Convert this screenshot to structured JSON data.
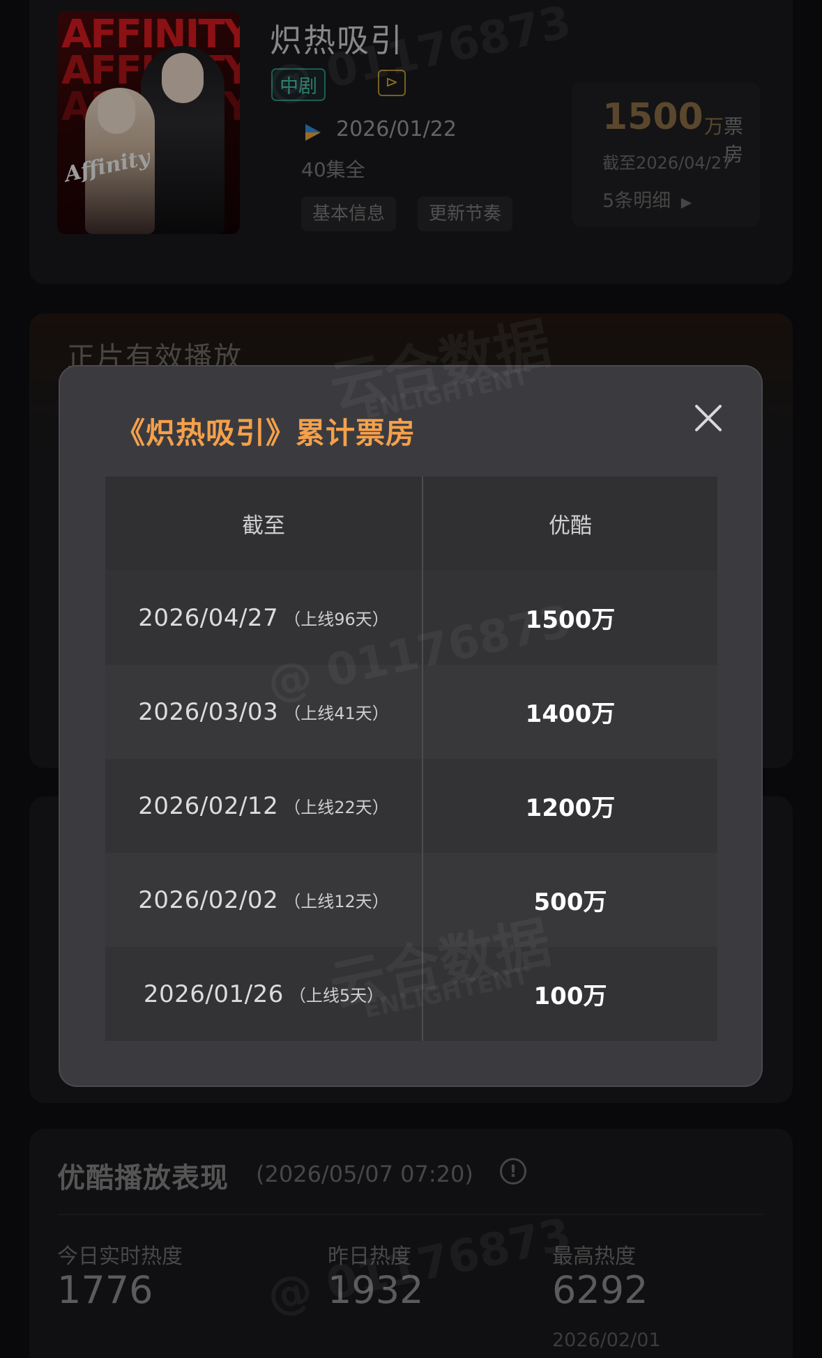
{
  "header": {
    "title": "炽热吸引",
    "genre_tag": "中剧",
    "release_date": "2026/01/22",
    "episodes": "40集全",
    "chips": [
      "基本信息",
      "更新节奏"
    ],
    "poster_title": "AFFINITY",
    "box_office": {
      "value": "1500",
      "unit": "万",
      "label": "票房",
      "as_of": "截至2026/04/27",
      "details_link": "5条明细"
    }
  },
  "play_section": {
    "title": "正片有效播放"
  },
  "modal": {
    "title": "《炽热吸引》累计票房",
    "columns": [
      "截至",
      "优酷"
    ],
    "rows": [
      {
        "date": "2026/04/27",
        "days": "（上线96天）",
        "amount": "1500万"
      },
      {
        "date": "2026/03/03",
        "days": "（上线41天）",
        "amount": "1400万"
      },
      {
        "date": "2026/02/12",
        "days": "（上线22天）",
        "amount": "1200万"
      },
      {
        "date": "2026/02/02",
        "days": "（上线12天）",
        "amount": "500万"
      },
      {
        "date": "2026/01/26",
        "days": "（上线5天）",
        "amount": "100万"
      }
    ]
  },
  "youku": {
    "title": "优酷播放表现",
    "timestamp": "(2026/05/07 07:20)",
    "stats": [
      {
        "label": "今日实时热度",
        "value": "1776",
        "date": ""
      },
      {
        "label": "昨日热度",
        "value": "1932",
        "date": ""
      },
      {
        "label": "最高热度",
        "value": "6292",
        "date": "2026/02/01"
      }
    ]
  },
  "watermarks": {
    "user_id": "@ 01176873",
    "brand": "云合数据",
    "brand_en": "ENLIGHTENT"
  },
  "colors": {
    "modal_title": "#f5a04b",
    "box_office_value": "#8a6d45",
    "genre_tag": "#3fbfa6"
  }
}
